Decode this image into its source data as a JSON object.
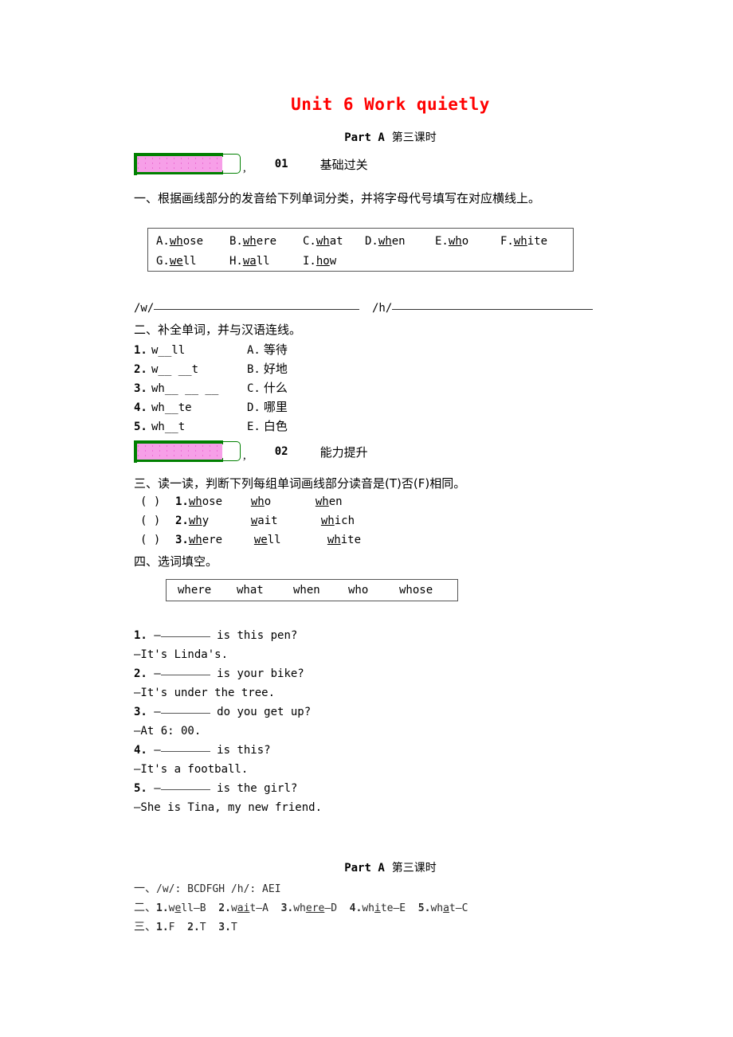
{
  "document": {
    "title": "Unit 6 Work quietly",
    "title_color": "#ff0000",
    "subtitle_part": "Part A",
    "subtitle_lesson": "第三课时"
  },
  "sections": [
    {
      "number": "01",
      "label": "基础过关",
      "badge_colors": {
        "border": "#008000",
        "fill": "#f79fe8"
      },
      "comma": ","
    },
    {
      "number": "02",
      "label": "能力提升",
      "badge_colors": {
        "border": "#008000",
        "fill": "#f79fe8"
      },
      "comma": ","
    }
  ],
  "exercise1": {
    "heading": "一、根据画线部分的发音给下列单词分类，并将字母代号填写在对应横线上。",
    "wordbank_row1": [
      {
        "letter": "A.",
        "pre": "",
        "mark": "wh",
        "post": "ose"
      },
      {
        "letter": "B.",
        "pre": "",
        "mark": "wh",
        "post": "ere"
      },
      {
        "letter": "C.",
        "pre": "",
        "mark": "wh",
        "post": "at"
      },
      {
        "letter": "D.",
        "pre": "",
        "mark": "wh",
        "post": "en"
      },
      {
        "letter": "E.",
        "pre": "",
        "mark": "wh",
        "post": "o"
      },
      {
        "letter": "F.",
        "pre": "",
        "mark": "wh",
        "post": "ite"
      }
    ],
    "wordbank_row2": [
      {
        "letter": "G.",
        "pre": "",
        "mark": "we",
        "post": "ll"
      },
      {
        "letter": "H.",
        "pre": "",
        "mark": "wa",
        "post": "ll"
      },
      {
        "letter": "I.",
        "pre": "",
        "mark": "ho",
        "post": "w"
      }
    ],
    "blank_w_label": "/w/",
    "blank_h_label": "/h/"
  },
  "exercise2": {
    "heading": "二、补全单词，并与汉语连线。",
    "items": [
      {
        "num": "1.",
        "word_pre": "w",
        "blanks": 1,
        "word_post": "ll",
        "raw": "w__ll",
        "opt": "A.",
        "meaning": "等待"
      },
      {
        "num": "2.",
        "word_pre": "w",
        "blanks": 2,
        "word_post": "t",
        "raw": "w__ __t",
        "opt": "B.",
        "meaning": "好地"
      },
      {
        "num": "3.",
        "word_pre": "wh",
        "blanks": 3,
        "word_post": "",
        "raw": "wh__ __ __",
        "opt": "C.",
        "meaning": "什么"
      },
      {
        "num": "4.",
        "word_pre": "wh",
        "blanks": 1,
        "word_post": "te",
        "raw": "wh__te",
        "opt": "D.",
        "meaning": "哪里"
      },
      {
        "num": "5.",
        "word_pre": "wh",
        "blanks": 1,
        "word_post": "t",
        "raw": "wh__t",
        "opt": "E.",
        "meaning": "白色"
      }
    ]
  },
  "exercise3": {
    "heading": "三、读一读，判断下列每组单词画线部分读音是(T)否(F)相同。",
    "rows": [
      {
        "paren": "(    )",
        "idx": "1.",
        "words": [
          {
            "mark": "wh",
            "post": "ose"
          },
          {
            "mark": "wh",
            "post": "o"
          },
          {
            "mark": "wh",
            "post": "en"
          }
        ]
      },
      {
        "paren": "(    )",
        "idx": "2.",
        "words": [
          {
            "mark": "wh",
            "post": "y"
          },
          {
            "mark": "w",
            "post": "ait"
          },
          {
            "mark": "wh",
            "post": "ich"
          }
        ]
      },
      {
        "paren": "(    )",
        "idx": "3.",
        "words": [
          {
            "mark": "wh",
            "post": "ere"
          },
          {
            "mark": "we",
            "post": "ll"
          },
          {
            "mark": "wh",
            "post": "ite"
          }
        ]
      }
    ]
  },
  "exercise4": {
    "heading": "四、选词填空。",
    "wordbank": [
      "where",
      "what",
      "when",
      "who",
      "whose"
    ],
    "items": [
      {
        "num": "1.",
        "q_pre": "—",
        "q_post": " is this pen?",
        "answer": "—It's Linda's."
      },
      {
        "num": "2.",
        "q_pre": "—",
        "q_post": " is your bike?",
        "answer": "—It's under the tree."
      },
      {
        "num": "3.",
        "q_pre": "—",
        "q_post": " do you get up?",
        "answer": "—At 6: 00."
      },
      {
        "num": "4.",
        "q_pre": "—",
        "q_post": " is this?",
        "answer": "—It's a football."
      },
      {
        "num": "5.",
        "q_pre": "—",
        "q_post": " is the girl?",
        "answer": "—She is Tina, my new friend."
      }
    ]
  },
  "answer_key": {
    "title_part": "Part A",
    "title_lesson": "第三课时",
    "line1_label": "一、",
    "line1_body": "/w/: BCDFGH   /h/: AEI",
    "line2_label": "二、",
    "line2_items": [
      {
        "num": "1.",
        "pre": "w",
        "mark": "e",
        "post": "ll",
        "dash": "—",
        "ans": "B"
      },
      {
        "num": "2.",
        "pre": "w",
        "mark": "ai",
        "post": "t",
        "dash": "—",
        "ans": "A"
      },
      {
        "num": "3.",
        "pre": "wh",
        "mark": "ere",
        "post": "",
        "dash": "—",
        "ans": "D"
      },
      {
        "num": "4.",
        "pre": "wh",
        "mark": "i",
        "post": "te",
        "dash": "—",
        "ans": "E"
      },
      {
        "num": "5.",
        "pre": "wh",
        "mark": "a",
        "post": "t",
        "dash": "—",
        "ans": "C"
      }
    ],
    "line3_label": "三、",
    "line3_items": [
      {
        "num": "1.",
        "val": "F"
      },
      {
        "num": "2.",
        "val": "T"
      },
      {
        "num": "3.",
        "val": "T"
      }
    ]
  }
}
